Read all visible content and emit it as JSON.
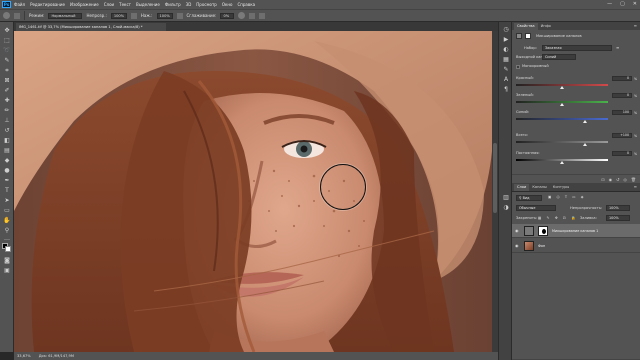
{
  "app": {
    "logo": "Ps"
  },
  "menu": [
    "Файл",
    "Редактирование",
    "Изображение",
    "Слои",
    "Текст",
    "Выделение",
    "Фильтр",
    "3D",
    "Просмотр",
    "Окно",
    "Справка"
  ],
  "window_controls": [
    "—",
    "▢",
    "✕"
  ],
  "options": {
    "mode_label": "Режим:",
    "mode_value": "Нормальный",
    "opacity_label": "Непрозр.:",
    "opacity_value": "100%",
    "flow_label": "Наж.:",
    "flow_value": "100%",
    "smoothing_label": "Сглаживание:",
    "smoothing_value": "0%"
  },
  "document": {
    "tab_title": "IMG_1461.tif @ 33,7% (Микширование каналов 1, Слой-маска/8) *"
  },
  "status": {
    "zoom": "33,67%",
    "doc_size": "Док: 61,9М/147,9М"
  },
  "properties_panel": {
    "tabs": [
      "Свойства",
      "Инфо"
    ],
    "adjustment_title": "Микширование каналов",
    "preset_label": "Набор:",
    "preset_value": "Заказная",
    "output_label": "Выходной канал:",
    "output_value": "Синий",
    "monochrome_label": "Монохромный",
    "sliders": [
      {
        "label": "Красный:",
        "value": 0,
        "display": "0",
        "color": "#d14a4a"
      },
      {
        "label": "Зеленый:",
        "value": 0,
        "display": "0",
        "color": "#4ab24a"
      },
      {
        "label": "Синий:",
        "value": 100,
        "display": "100",
        "color": "#4a6ad1"
      },
      {
        "label": "Всего:",
        "value": 100,
        "display": "+100",
        "color": "#9a9a9a"
      }
    ],
    "constant_label": "Постоянная:",
    "constant_value": "0",
    "percent": "%"
  },
  "layers_panel": {
    "tabs": [
      "Слои",
      "Каналы",
      "Контуры"
    ],
    "filter_label": "Вид",
    "blend_mode": "Обычные",
    "opacity_label": "Непрозрачность:",
    "opacity_value": "100%",
    "lock_label": "Закрепить:",
    "fill_label": "Заливка:",
    "fill_value": "100%",
    "layers": [
      {
        "name": "Микширование каналов 1",
        "selected": true
      },
      {
        "name": "Фон",
        "selected": false
      }
    ]
  }
}
